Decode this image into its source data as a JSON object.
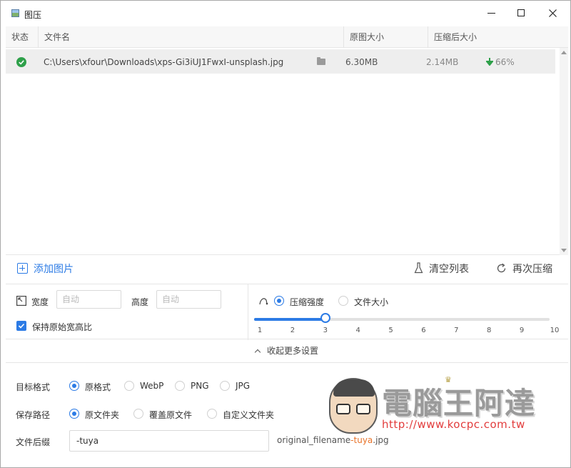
{
  "window": {
    "title": "图压"
  },
  "table": {
    "headers": {
      "status": "状态",
      "name": "文件名",
      "orig": "原图大小",
      "comp": "压缩后大小"
    },
    "rows": [
      {
        "path": "C:\\Users\\xfour\\Downloads\\xps-Gi3iUJ1FwxI-unsplash.jpg",
        "orig": "6.30MB",
        "comp": "2.14MB",
        "saved": "66%"
      }
    ]
  },
  "actions": {
    "add": "添加图片",
    "clear": "清空列表",
    "recompress": "再次压缩"
  },
  "resize": {
    "width_label": "宽度",
    "width_placeholder": "自动",
    "height_label": "高度",
    "height_placeholder": "自动",
    "keep_ratio": "保持原始宽高比",
    "keep_ratio_checked": true
  },
  "compression": {
    "mode_strength": "压缩强度",
    "mode_size": "文件大小",
    "selected_mode": "strength",
    "ticks": [
      "1",
      "2",
      "3",
      "4",
      "5",
      "6",
      "7",
      "8",
      "9",
      "10"
    ],
    "value": 3,
    "min": 1,
    "max": 10
  },
  "collapse_label": "收起更多设置",
  "target_format": {
    "label": "目标格式",
    "options": [
      "原格式",
      "WebP",
      "PNG",
      "JPG"
    ],
    "selected": "原格式"
  },
  "save_path": {
    "label": "保存路径",
    "options": [
      "原文件夹",
      "覆盖原文件",
      "自定义文件夹"
    ],
    "selected": "原文件夹"
  },
  "suffix": {
    "label": "文件后缀",
    "value": "-tuya",
    "preview_base": "original_filename",
    "preview_suffix": "-tuya",
    "preview_ext": ".jpg"
  },
  "watermark": {
    "title": "電腦王阿達",
    "url": "http://www.kocpc.com.tw"
  },
  "colors": {
    "accent": "#2c7be5",
    "success": "#2ea04a",
    "suffix_highlight": "#e8732a"
  }
}
